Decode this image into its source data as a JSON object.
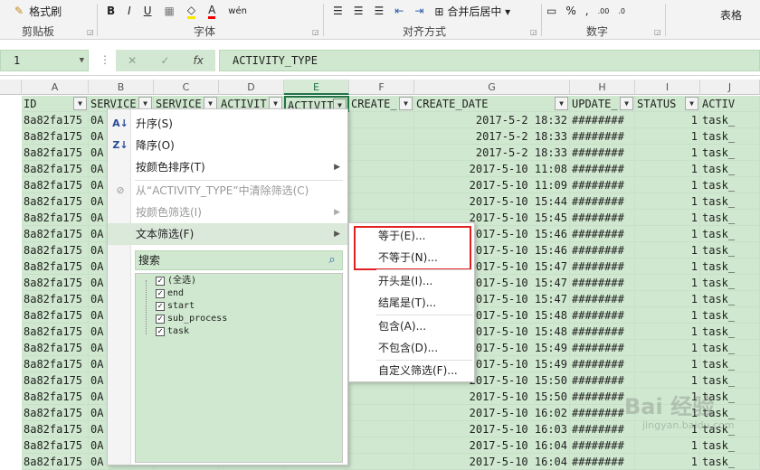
{
  "ribbon": {
    "clipboard_label": "剪贴板",
    "format_painter": "格式刷",
    "font_label": "字体",
    "align_label": "对齐方式",
    "merge_center": "合并后居中",
    "number_label": "数字",
    "percent": "%",
    "table_label": "表格"
  },
  "formula_bar": {
    "name_box": "1",
    "fx": "fx",
    "content": "ACTIVITY_TYPE"
  },
  "columns": [
    "A",
    "B",
    "C",
    "D",
    "E",
    "F",
    "G",
    "H",
    "I",
    "J"
  ],
  "headers": [
    "ID",
    "SERVICE",
    "SERVICE",
    "ACTIVIT",
    "ACTIVIT",
    "CREATE_",
    "CREATE_DATE",
    "UPDATE_",
    "STATUS",
    "ACTIV"
  ],
  "rows": [
    {
      "id": "8a82fa175",
      "b": "0A",
      "date": "2017-5-2 18:32",
      "upd": "########",
      "status": "1",
      "act": "task_"
    },
    {
      "id": "8a82fa175",
      "b": "0A",
      "date": "2017-5-2 18:33",
      "upd": "########",
      "status": "1",
      "act": "task_"
    },
    {
      "id": "8a82fa175",
      "b": "0A",
      "date": "2017-5-2 18:33",
      "upd": "########",
      "status": "1",
      "act": "task_"
    },
    {
      "id": "8a82fa175",
      "b": "0A",
      "date": "2017-5-10 11:08",
      "upd": "########",
      "status": "1",
      "act": "task_"
    },
    {
      "id": "8a82fa175",
      "b": "0A",
      "date": "2017-5-10 11:09",
      "upd": "########",
      "status": "1",
      "act": "task_"
    },
    {
      "id": "8a82fa175",
      "b": "0A",
      "date": "2017-5-10 15:44",
      "upd": "########",
      "status": "1",
      "act": "task_"
    },
    {
      "id": "8a82fa175",
      "b": "0A",
      "date": "2017-5-10 15:45",
      "upd": "########",
      "status": "1",
      "act": "task_"
    },
    {
      "id": "8a82fa175",
      "b": "0A",
      "date": "2017-5-10 15:46",
      "upd": "########",
      "status": "1",
      "act": "task_"
    },
    {
      "id": "8a82fa175",
      "b": "0A",
      "date": "2017-5-10 15:46",
      "upd": "########",
      "status": "1",
      "act": "task_"
    },
    {
      "id": "8a82fa175",
      "b": "0A",
      "date": "2017-5-10 15:47",
      "upd": "########",
      "status": "1",
      "act": "task_"
    },
    {
      "id": "8a82fa175",
      "b": "0A",
      "date": "2017-5-10 15:47",
      "upd": "########",
      "status": "1",
      "act": "task_"
    },
    {
      "id": "8a82fa175",
      "b": "0A",
      "date": "2017-5-10 15:47",
      "upd": "########",
      "status": "1",
      "act": "task_"
    },
    {
      "id": "8a82fa175",
      "b": "0A",
      "date": "2017-5-10 15:48",
      "upd": "########",
      "status": "1",
      "act": "task_"
    },
    {
      "id": "8a82fa175",
      "b": "0A",
      "date": "2017-5-10 15:48",
      "upd": "########",
      "status": "1",
      "act": "task_"
    },
    {
      "id": "8a82fa175",
      "b": "0A",
      "date": "2017-5-10 15:49",
      "upd": "########",
      "status": "1",
      "act": "task_"
    },
    {
      "id": "8a82fa175",
      "b": "0A",
      "date": "2017-5-10 15:49",
      "upd": "########",
      "status": "1",
      "act": "task_"
    },
    {
      "id": "8a82fa175",
      "b": "0A",
      "date": "2017-5-10 15:50",
      "upd": "########",
      "status": "1",
      "act": "task_"
    },
    {
      "id": "8a82fa175",
      "b": "0A",
      "date": "2017-5-10 15:50",
      "upd": "########",
      "status": "1",
      "act": "task_"
    },
    {
      "id": "8a82fa175",
      "b": "0A",
      "date": "2017-5-10 16:02",
      "upd": "########",
      "status": "1",
      "act": "task_"
    },
    {
      "id": "8a82fa175",
      "b": "0A",
      "date": "2017-5-10 16:03",
      "upd": "########",
      "status": "1",
      "act": "task_"
    },
    {
      "id": "8a82fa175",
      "b": "0A",
      "date": "2017-5-10 16:04",
      "upd": "########",
      "status": "1",
      "act": "task_"
    },
    {
      "id": "8a82fa175",
      "b": "0A",
      "date": "2017-5-10 16:04",
      "upd": "########",
      "status": "1",
      "act": "task_"
    }
  ],
  "menu": {
    "sort_asc": "升序(S)",
    "sort_desc": "降序(O)",
    "sort_color": "按颜色排序(T)",
    "clear_filter": "从“ACTIVITY_TYPE”中清除筛选(C)",
    "color_filter": "按颜色筛选(I)",
    "text_filter": "文本筛选(F)",
    "search_placeholder": "搜索",
    "items": [
      "(全选)",
      "end",
      "start",
      "sub_process",
      "task"
    ]
  },
  "submenu": {
    "equals": "等于(E)...",
    "not_equals": "不等于(N)...",
    "begins_with": "开头是(I)...",
    "ends_with": "结尾是(T)...",
    "contains": "包含(A)...",
    "not_contains": "不包含(D)...",
    "custom": "自定义筛选(F)..."
  },
  "watermark": {
    "text": "Bai 经验",
    "url": "jingyan.baidu.com"
  }
}
